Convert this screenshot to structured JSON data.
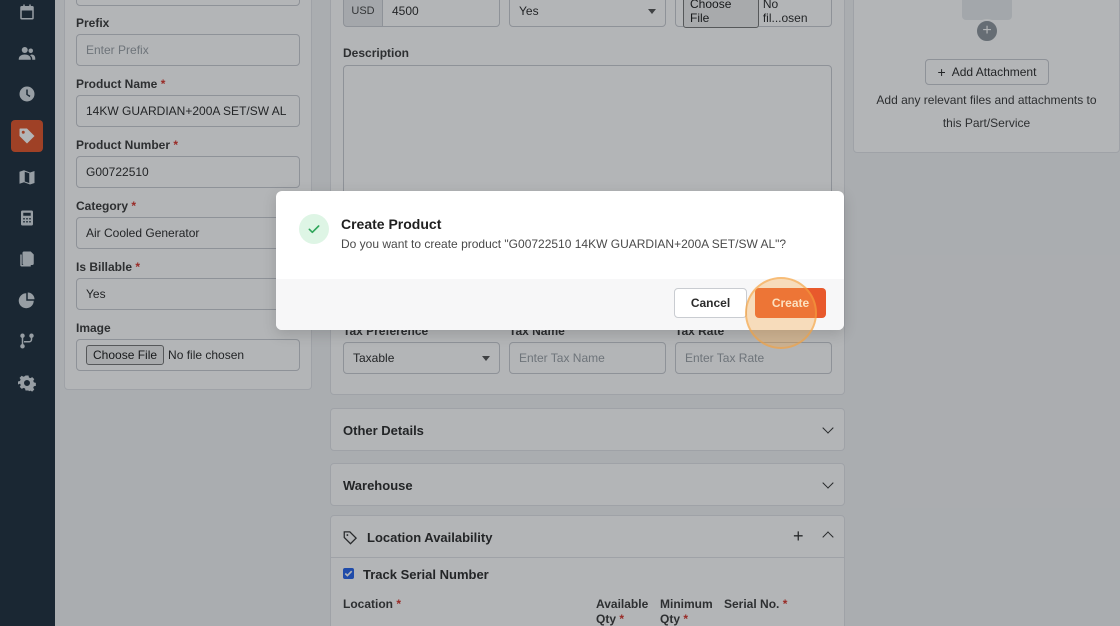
{
  "sidebar": {
    "items": [
      {
        "icon": "calendar-icon"
      },
      {
        "icon": "users-icon"
      },
      {
        "icon": "clock-icon"
      },
      {
        "icon": "tag-icon",
        "active": true
      },
      {
        "icon": "map-icon"
      },
      {
        "icon": "calculator-icon"
      },
      {
        "icon": "documents-icon"
      },
      {
        "icon": "pie-chart-icon"
      },
      {
        "icon": "workflow-icon"
      },
      {
        "icon": "gear-icon"
      }
    ]
  },
  "left_form": {
    "prefix_label": "Prefix",
    "prefix_placeholder": "Enter Prefix",
    "product_name_label": "Product Name",
    "product_name_value": "14KW GUARDIAN+200A SET/SW AL",
    "product_number_label": "Product Number",
    "product_number_value": "G00722510",
    "category_label": "Category",
    "category_value": "Air Cooled Generator",
    "billable_label": "Is Billable",
    "billable_value": "Yes",
    "image_label": "Image",
    "image_button": "Choose File",
    "image_status": "No file chosen",
    "required_mark": "*"
  },
  "middle_form": {
    "currency": "USD",
    "price_value": "4500",
    "select_value": "Yes",
    "file_button": "Choose File",
    "file_status": "No fil...osen",
    "description_label": "Description",
    "tax_preference_label": "Tax Preference",
    "tax_preference_value": "Taxable",
    "tax_name_label": "Tax Name",
    "tax_name_placeholder": "Enter Tax Name",
    "tax_rate_label": "Tax Rate",
    "tax_rate_placeholder": "Enter Tax Rate"
  },
  "attachments": {
    "button_label": "Add Attachment",
    "help_text": "Add any relevant files and attachments to this Part/Service"
  },
  "panels": {
    "other_details": "Other Details",
    "warehouse": "Warehouse",
    "location_availability": "Location Availability",
    "track_serial_label": "Track Serial Number",
    "location_label": "Location",
    "available_qty_label": "Available Qty",
    "minimum_qty_label": "Minimum Qty",
    "serial_no_label": "Serial No."
  },
  "modal": {
    "title": "Create Product",
    "message": "Do you want to create product \"G00722510 14KW GUARDIAN+200A SET/SW AL\"?",
    "cancel_label": "Cancel",
    "create_label": "Create"
  },
  "colors": {
    "sidebar_bg": "#1e2f3d",
    "accent": "#e8592c",
    "success": "#2fa55a"
  }
}
